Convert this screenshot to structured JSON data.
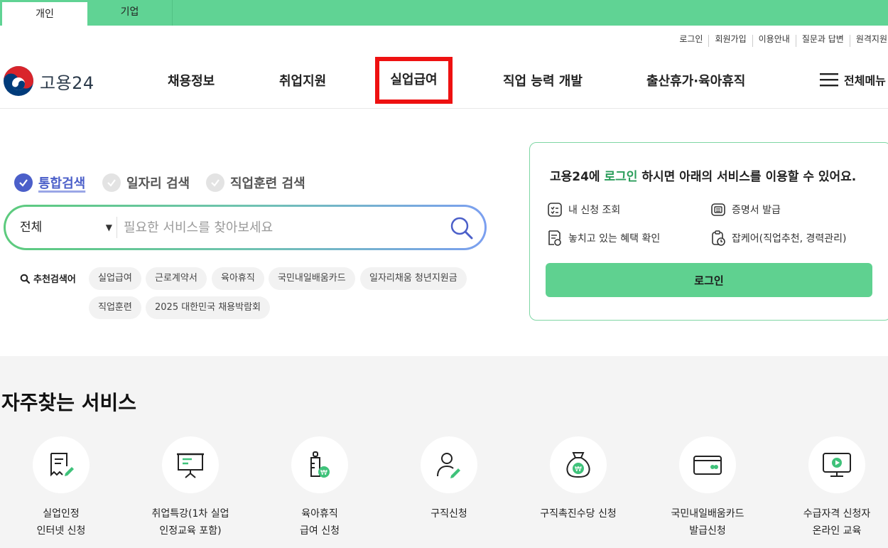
{
  "user_tabs": {
    "personal": "개인",
    "business": "기업"
  },
  "util_links": [
    "로그인",
    "회원가입",
    "이용안내",
    "질문과 답변",
    "원격지원"
  ],
  "logo": {
    "text": "고용24"
  },
  "gnb": [
    "채용정보",
    "취업지원",
    "실업급여",
    "직업 능력 개발",
    "출산휴가·육아휴직"
  ],
  "all_menu": "전체메뉴",
  "search_types": [
    {
      "label": "통합검색",
      "checked": true
    },
    {
      "label": "일자리 검색",
      "checked": false
    },
    {
      "label": "직업훈련 검색",
      "checked": false
    }
  ],
  "search": {
    "category": "전체",
    "placeholder": "필요한 서비스를 찾아보세요"
  },
  "recommended": {
    "label": "추천검색어",
    "keywords": [
      "실업급여",
      "근로계약서",
      "육아휴직",
      "국민내일배움카드",
      "일자리채움 청년지원금",
      "직업훈련",
      "2025 대한민국 채용박람회"
    ]
  },
  "login_card": {
    "title_pre": "고용24에 ",
    "title_link": "로그인",
    "title_post": " 하시면 아래의 서비스를 이용할 수 있어요.",
    "items": [
      "내 신청 조회",
      "증명서 발급",
      "놓치고 있는 혜택 확인",
      "잡케어(직업추천, 경력관리)"
    ],
    "button": "로그인"
  },
  "services": {
    "title": "자주찾는 서비스",
    "items": [
      {
        "label": "실업인정\n인터넷 신청",
        "icon": "document-pen-icon"
      },
      {
        "label": "취업특강(1차 실업\n인정교육 포함)",
        "icon": "presentation-board-icon"
      },
      {
        "label": "육아휴직\n급여 신청",
        "icon": "baby-bottle-icon"
      },
      {
        "label": "구직신청",
        "icon": "person-pen-icon"
      },
      {
        "label": "구직촉진수당 신청",
        "icon": "money-bag-icon"
      },
      {
        "label": "국민내일배움카드\n발급신청",
        "icon": "card-icon"
      },
      {
        "label": "수급자격 신청자\n온라인 교육",
        "icon": "monitor-play-icon"
      }
    ]
  },
  "colors": {
    "brand_green": "#60d394",
    "highlight_red": "#ee1111",
    "accent_blue": "#4b5fc9"
  }
}
